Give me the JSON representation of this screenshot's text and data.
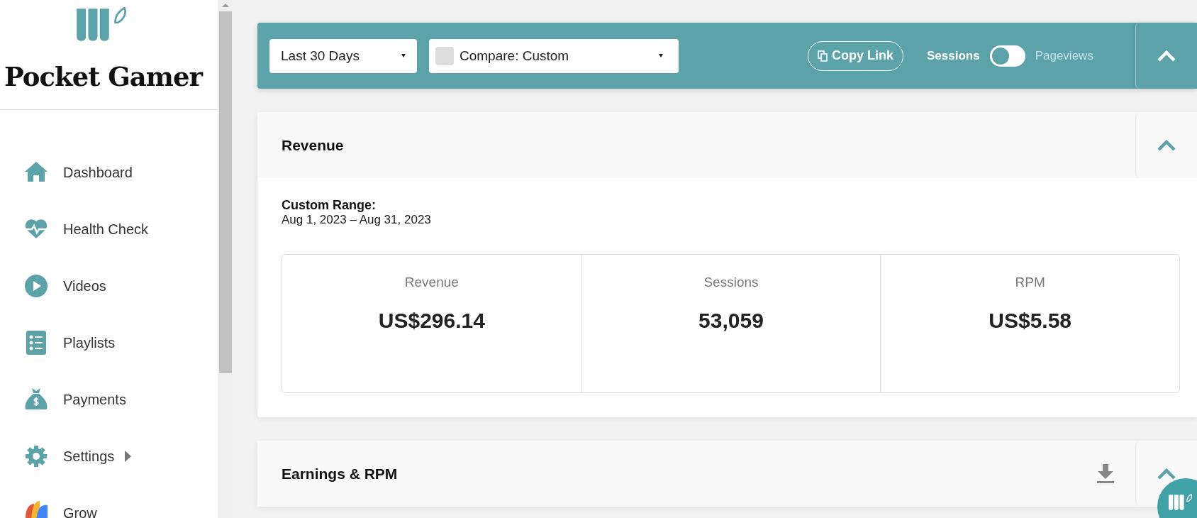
{
  "sidebar": {
    "brand": "Pocket Gamer",
    "items": [
      {
        "label": "Dashboard",
        "has_submenu": false
      },
      {
        "label": "Health Check",
        "has_submenu": false
      },
      {
        "label": "Videos",
        "has_submenu": false
      },
      {
        "label": "Playlists",
        "has_submenu": false
      },
      {
        "label": "Payments",
        "has_submenu": false
      },
      {
        "label": "Settings",
        "has_submenu": true
      },
      {
        "label": "Grow",
        "has_submenu": false
      }
    ]
  },
  "toolbar": {
    "range": "Last 30 Days",
    "compare": "Compare: Custom",
    "copy_link": "Copy Link",
    "toggle": {
      "left_label": "Sessions",
      "right_label": "Pageviews",
      "on": false
    },
    "expanded": true
  },
  "revenue": {
    "title": "Revenue",
    "expanded": true,
    "range_label": "Custom Range:",
    "range_dates": "Aug 1, 2023 – Aug 31, 2023",
    "stats": [
      {
        "label": "Revenue",
        "value": "US$296.14"
      },
      {
        "label": "Sessions",
        "value": "53,059"
      },
      {
        "label": "RPM",
        "value": "US$5.58"
      }
    ]
  },
  "earnings": {
    "title": "Earnings & RPM",
    "expanded": true
  }
}
